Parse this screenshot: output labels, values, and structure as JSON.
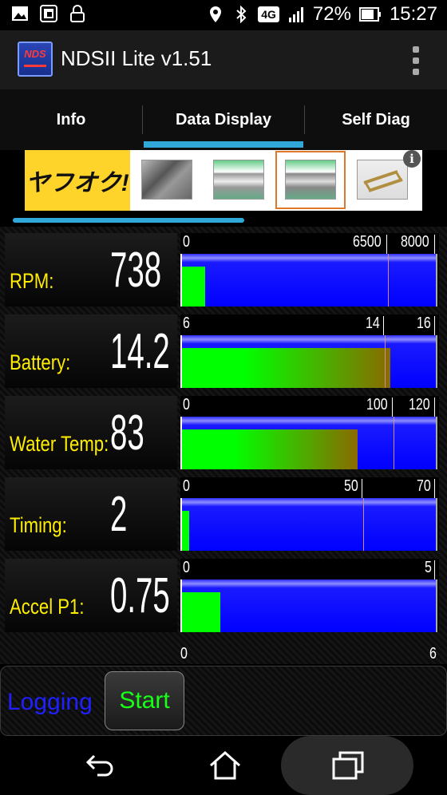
{
  "status_bar": {
    "battery_percent": "72%",
    "time": "15:27",
    "network_badge": "4G",
    "icons": [
      "image-icon",
      "gallery-icon",
      "lock-icon",
      "location-icon",
      "bluetooth-icon",
      "signal-icon",
      "battery-icon"
    ]
  },
  "app": {
    "logo_text": "NDS",
    "title": "NDSII Lite v1.51"
  },
  "tabs": [
    {
      "label": "Info",
      "active": false
    },
    {
      "label": "Data Display",
      "active": true
    },
    {
      "label": "Self Diag",
      "active": false
    }
  ],
  "ad": {
    "logo_text": "ヤフオク!",
    "info_glyph": "i",
    "thumbnails": [
      "engine-part-image",
      "grille-image",
      "grille-image-selected",
      "rack-image"
    ]
  },
  "rows": [
    {
      "label": "RPM:",
      "value": "738",
      "min": 0,
      "max": 8000,
      "current": 738,
      "ticks": [
        "0",
        "6500",
        "8000"
      ],
      "marker": 6500,
      "fill": "green"
    },
    {
      "label": "Battery:",
      "value": "14.2",
      "min": 6,
      "max": 16,
      "current": 14.2,
      "ticks": [
        "6",
        "14",
        "16"
      ],
      "marker": 14,
      "fill": "gradient"
    },
    {
      "label": "Water Temp:",
      "value": "83",
      "min": 0,
      "max": 120,
      "current": 83,
      "ticks": [
        "0",
        "100",
        "120"
      ],
      "marker": 100,
      "fill": "gradient"
    },
    {
      "label": "Timing:",
      "value": "2",
      "min": 0,
      "max": 70,
      "current": 2,
      "ticks": [
        "0",
        "50",
        "70"
      ],
      "marker": 50,
      "fill": "green"
    },
    {
      "label": "Accel P1:",
      "value": "0.75",
      "min": 0,
      "max": 5,
      "current": 0.75,
      "ticks": [
        "0",
        "5"
      ],
      "marker": null,
      "fill": "green"
    }
  ],
  "partial_row": {
    "ticks": [
      "0",
      "6"
    ]
  },
  "controls": {
    "logging_label": "Logging",
    "start_label": "Start"
  },
  "colors": {
    "accent": "#30a8d8",
    "label_yellow": "#ffee00",
    "bar_blue": "#0000ff",
    "bar_green": "#00ff00",
    "logging_blue": "#2020ff",
    "start_green": "#18ff18"
  }
}
